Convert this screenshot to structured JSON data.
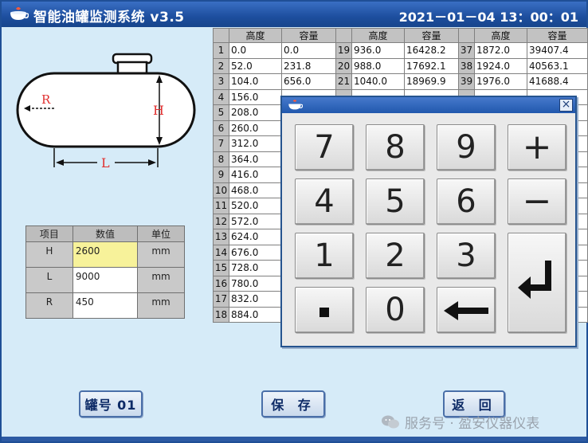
{
  "title_bar": {
    "title": "智能油罐监测系统 v3.5",
    "clock": "2021－01－04  13：00：01"
  },
  "tank_diagram": {
    "label_r": "R",
    "label_h": "H",
    "label_l": "L"
  },
  "param_table": {
    "headers": [
      "项目",
      "数值",
      "单位"
    ],
    "rows": [
      {
        "item": "H",
        "value": "2600",
        "unit": "mm"
      },
      {
        "item": "L",
        "value": "9000",
        "unit": "mm"
      },
      {
        "item": "R",
        "value": "450",
        "unit": "mm"
      }
    ]
  },
  "volume_table": {
    "headers": [
      "高度",
      "容量"
    ],
    "col1": [
      {
        "i": "1",
        "h": "0.0",
        "v": "0.0"
      },
      {
        "i": "2",
        "h": "52.0",
        "v": "231.8"
      },
      {
        "i": "3",
        "h": "104.0",
        "v": "656.0"
      },
      {
        "i": "4",
        "h": "156.0",
        "v": ""
      },
      {
        "i": "5",
        "h": "208.0",
        "v": ""
      },
      {
        "i": "6",
        "h": "260.0",
        "v": ""
      },
      {
        "i": "7",
        "h": "312.0",
        "v": ""
      },
      {
        "i": "8",
        "h": "364.0",
        "v": ""
      },
      {
        "i": "9",
        "h": "416.0",
        "v": ""
      },
      {
        "i": "10",
        "h": "468.0",
        "v": ""
      },
      {
        "i": "11",
        "h": "520.0",
        "v": ""
      },
      {
        "i": "12",
        "h": "572.0",
        "v": ""
      },
      {
        "i": "13",
        "h": "624.0",
        "v": ""
      },
      {
        "i": "14",
        "h": "676.0",
        "v": ""
      },
      {
        "i": "15",
        "h": "728.0",
        "v": ""
      },
      {
        "i": "16",
        "h": "780.0",
        "v": ""
      },
      {
        "i": "17",
        "h": "832.0",
        "v": ""
      },
      {
        "i": "18",
        "h": "884.0",
        "v": ""
      }
    ],
    "col2": [
      {
        "i": "19",
        "h": "936.0",
        "v": "16428.2"
      },
      {
        "i": "20",
        "h": "988.0",
        "v": "17692.1"
      },
      {
        "i": "21",
        "h": "1040.0",
        "v": "18969.9"
      }
    ],
    "col3": [
      {
        "i": "37",
        "h": "1872.0",
        "v": "39407.4"
      },
      {
        "i": "38",
        "h": "1924.0",
        "v": "40563.1"
      },
      {
        "i": "39",
        "h": "1976.0",
        "v": "41688.4"
      }
    ]
  },
  "keypad": {
    "keys": [
      "7",
      "8",
      "9",
      "+",
      "4",
      "5",
      "6",
      "−",
      "1",
      "2",
      "3",
      "0"
    ],
    "close": "×"
  },
  "buttons": {
    "tank": "罐号 01",
    "save": "保 存",
    "back": "返 回"
  },
  "watermark": "服务号 · 盈安仪器仪表"
}
